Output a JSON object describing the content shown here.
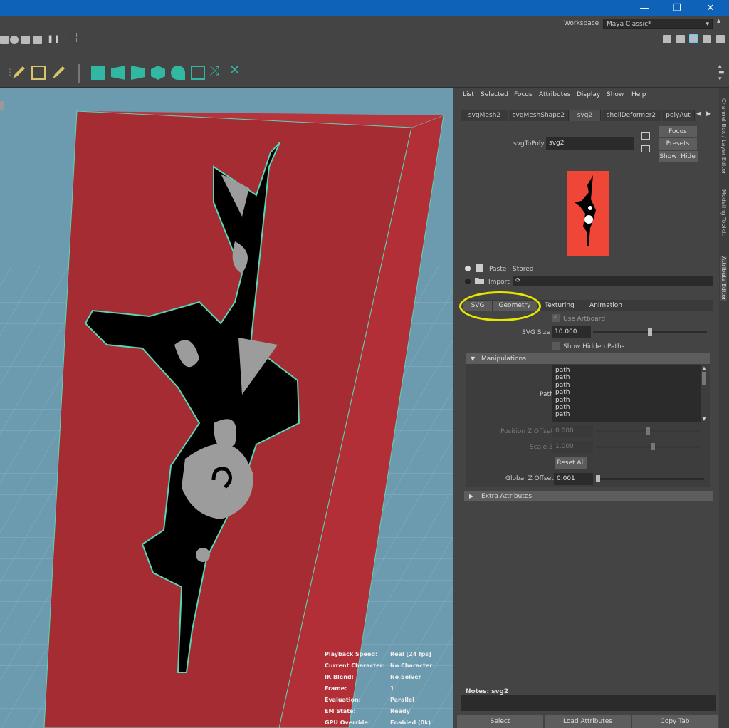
{
  "window": {
    "minimize": "—",
    "restore": "❐",
    "close": "✕"
  },
  "workspace": {
    "label": "Workspace :",
    "value": "Maya Classic*"
  },
  "attr_menu": [
    "List",
    "Selected",
    "Focus",
    "Attributes",
    "Display",
    "Show",
    "Help"
  ],
  "node_tabs": [
    "svgMesh2",
    "svgMeshShape2",
    "svg2",
    "shellDeformer2",
    "polyAut"
  ],
  "node": {
    "type_label": "svgToPoly:",
    "name": "svg2"
  },
  "buttons": {
    "focus": "Focus",
    "presets": "Presets",
    "show": "Show",
    "hide": "Hide"
  },
  "paste_row": {
    "paste": "Paste",
    "stored": "Stored"
  },
  "import_row": {
    "import": "Import"
  },
  "section_tabs": [
    "SVG",
    "Geometry",
    "Texturing",
    "Animation"
  ],
  "svg_attrs": {
    "use_artboard": "Use Artboard",
    "svg_size_label": "SVG Size",
    "svg_size": "10.000",
    "svg_size_level": 0.43,
    "show_hidden": "Show Hidden Paths"
  },
  "manipulations": {
    "title": "Manipulations",
    "path_label": "Path",
    "paths": [
      "path",
      "path",
      "path",
      "path",
      "path",
      "path",
      "path"
    ],
    "pos_z_label": "Position Z Offset",
    "pos_z": "0.000",
    "scale_z_label": "Scale Z",
    "scale_z": "1.000",
    "reset_all": "Reset All",
    "global_z_label": "Global Z Offset",
    "global_z": "0.001"
  },
  "extra": {
    "title": "Extra Attributes"
  },
  "notes": {
    "label": "Notes:  svg2"
  },
  "bottom_buttons": [
    "Select",
    "Load Attributes",
    "Copy Tab"
  ],
  "side_tabs": [
    "Channel Box / Layer Editor",
    "Modeling Toolkit",
    "Attribute Editor"
  ],
  "hud": [
    {
      "label": "Playback Speed:",
      "value": "Real [24 fps]"
    },
    {
      "label": "Current Character:",
      "value": "No Character"
    },
    {
      "label": "IK Blend:",
      "value": "No Solver"
    },
    {
      "label": "Frame:",
      "value": "1"
    },
    {
      "label": "Evaluation:",
      "value": "Parallel"
    },
    {
      "label": "EM State:",
      "value": "Ready"
    },
    {
      "label": "GPU Override:",
      "value": "Enabled (0k)"
    }
  ],
  "colors": {
    "titlebar": "#0e63b8",
    "viewport_bg": "#6c9bb0",
    "box_front": "#a52c33",
    "box_side": "#b32f37",
    "highlight": "#e6e600",
    "wireframe": "#57d7b5"
  }
}
